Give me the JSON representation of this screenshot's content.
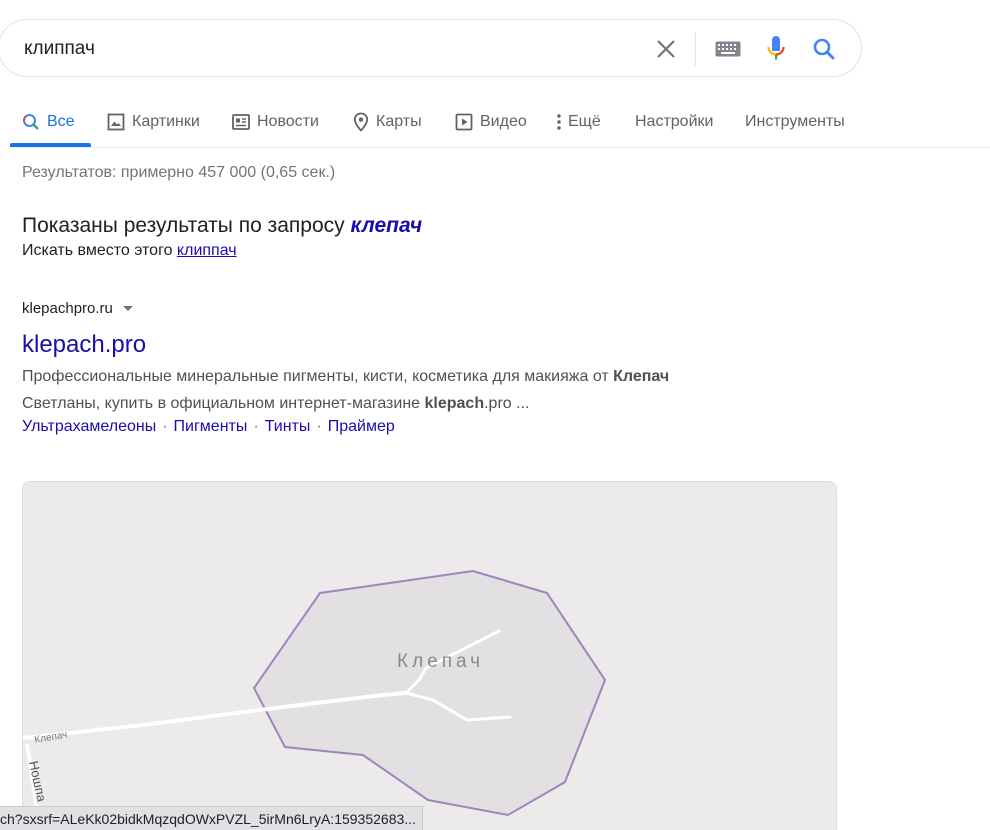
{
  "search": {
    "query": "клиппач"
  },
  "tabs": [
    {
      "label": "Все"
    },
    {
      "label": "Картинки"
    },
    {
      "label": "Новости"
    },
    {
      "label": "Карты"
    },
    {
      "label": "Видео"
    },
    {
      "label": "Ещё"
    },
    {
      "label": "Настройки"
    },
    {
      "label": "Инструменты"
    }
  ],
  "stats": "Результатов: примерно 457 000 (0,65 сек.)",
  "spelling": {
    "prefix": "Показаны результаты по запросу",
    "corrected": "клепач",
    "instead_prefix": "Искать вместо этого",
    "original_link": "клиппач"
  },
  "result": {
    "domain": "klepachpro.ru",
    "title": "klepach.pro",
    "snippet_1": "Профессиональные минеральные пигменты, кисти, косметика для макияжа от ",
    "snippet_1_bold": "Клепач",
    "snippet_2": "Светланы, купить в официальном интернет-магазине ",
    "snippet_2_bold": "klepach",
    "snippet_2_end": ".pro ...",
    "sitelinks": [
      "Ультрахамелеоны",
      "Пигменты",
      "Тинты",
      "Праймер"
    ]
  },
  "map": {
    "place_label": "Клепач",
    "road_label": "Клепач",
    "street_label": "Ношпа"
  },
  "statusbar": {
    "url": "ch?sxsrf=ALeKk02bidkMqzqdOWxPVZL_5irMn6LryA:159352683..."
  },
  "colors": {
    "link": "#1a0dab",
    "accent": "#1a73e8",
    "boundary": "#9c86bd"
  }
}
